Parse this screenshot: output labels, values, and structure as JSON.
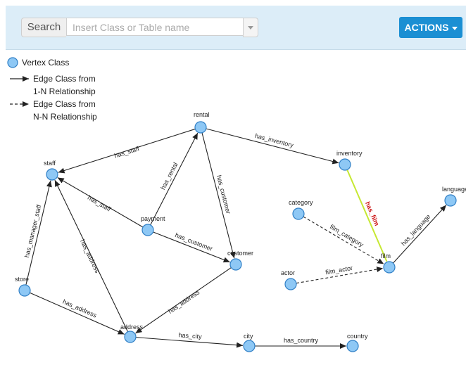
{
  "search": {
    "label": "Search",
    "placeholder": "Insert Class or Table name"
  },
  "actions_label": "ACTIONS",
  "legend": {
    "vertex": "Vertex Class",
    "edge_1n_line1": "Edge Class from",
    "edge_1n_line2": "1-N Relationship",
    "edge_nn_line1": "Edge Class from",
    "edge_nn_line2": "N-N Relationship"
  },
  "colors": {
    "node_fill": "#8ec8f5",
    "node_stroke": "#2f7fc6",
    "actions_bg": "#1b8fd3",
    "highlight_edge": "#c6e832",
    "highlight_label": "#cc1111"
  },
  "nodes": [
    {
      "id": "rental",
      "label": "rental"
    },
    {
      "id": "staff",
      "label": "staff"
    },
    {
      "id": "inventory",
      "label": "inventory"
    },
    {
      "id": "language",
      "label": "language"
    },
    {
      "id": "category",
      "label": "category"
    },
    {
      "id": "payment",
      "label": "payment"
    },
    {
      "id": "customer",
      "label": "customer"
    },
    {
      "id": "film",
      "label": "film"
    },
    {
      "id": "actor",
      "label": "actor"
    },
    {
      "id": "store",
      "label": "store"
    },
    {
      "id": "address",
      "label": "address"
    },
    {
      "id": "city",
      "label": "city"
    },
    {
      "id": "country",
      "label": "country"
    }
  ],
  "edges": [
    {
      "from": "rental",
      "to": "staff",
      "label": "has_staff",
      "type": "1-N"
    },
    {
      "from": "rental",
      "to": "inventory",
      "label": "has_inventory",
      "type": "1-N"
    },
    {
      "from": "rental",
      "to": "customer",
      "label": "has_customer",
      "type": "1-N"
    },
    {
      "from": "payment",
      "to": "rental",
      "label": "has_rental",
      "type": "1-N"
    },
    {
      "from": "payment",
      "to": "staff",
      "label": "has_staff",
      "type": "1-N"
    },
    {
      "from": "payment",
      "to": "customer",
      "label": "has_customer",
      "type": "1-N"
    },
    {
      "from": "inventory",
      "to": "film",
      "label": "has_film",
      "type": "1-N",
      "highlight": true
    },
    {
      "from": "film",
      "to": "language",
      "label": "has_language",
      "type": "1-N"
    },
    {
      "from": "category",
      "to": "film",
      "label": "film_category",
      "type": "N-N"
    },
    {
      "from": "actor",
      "to": "film",
      "label": "film_actor",
      "type": "N-N"
    },
    {
      "from": "store",
      "to": "staff",
      "label": "has_manager_staff",
      "type": "1-N"
    },
    {
      "from": "store",
      "to": "address",
      "label": "has_address",
      "type": "1-N"
    },
    {
      "from": "address",
      "to": "staff",
      "label": "has_address",
      "type": "1-N",
      "reverse": true
    },
    {
      "from": "customer",
      "to": "address",
      "label": "has_address",
      "type": "1-N"
    },
    {
      "from": "address",
      "to": "city",
      "label": "has_city",
      "type": "1-N"
    },
    {
      "from": "city",
      "to": "country",
      "label": "has_country",
      "type": "1-N"
    }
  ]
}
